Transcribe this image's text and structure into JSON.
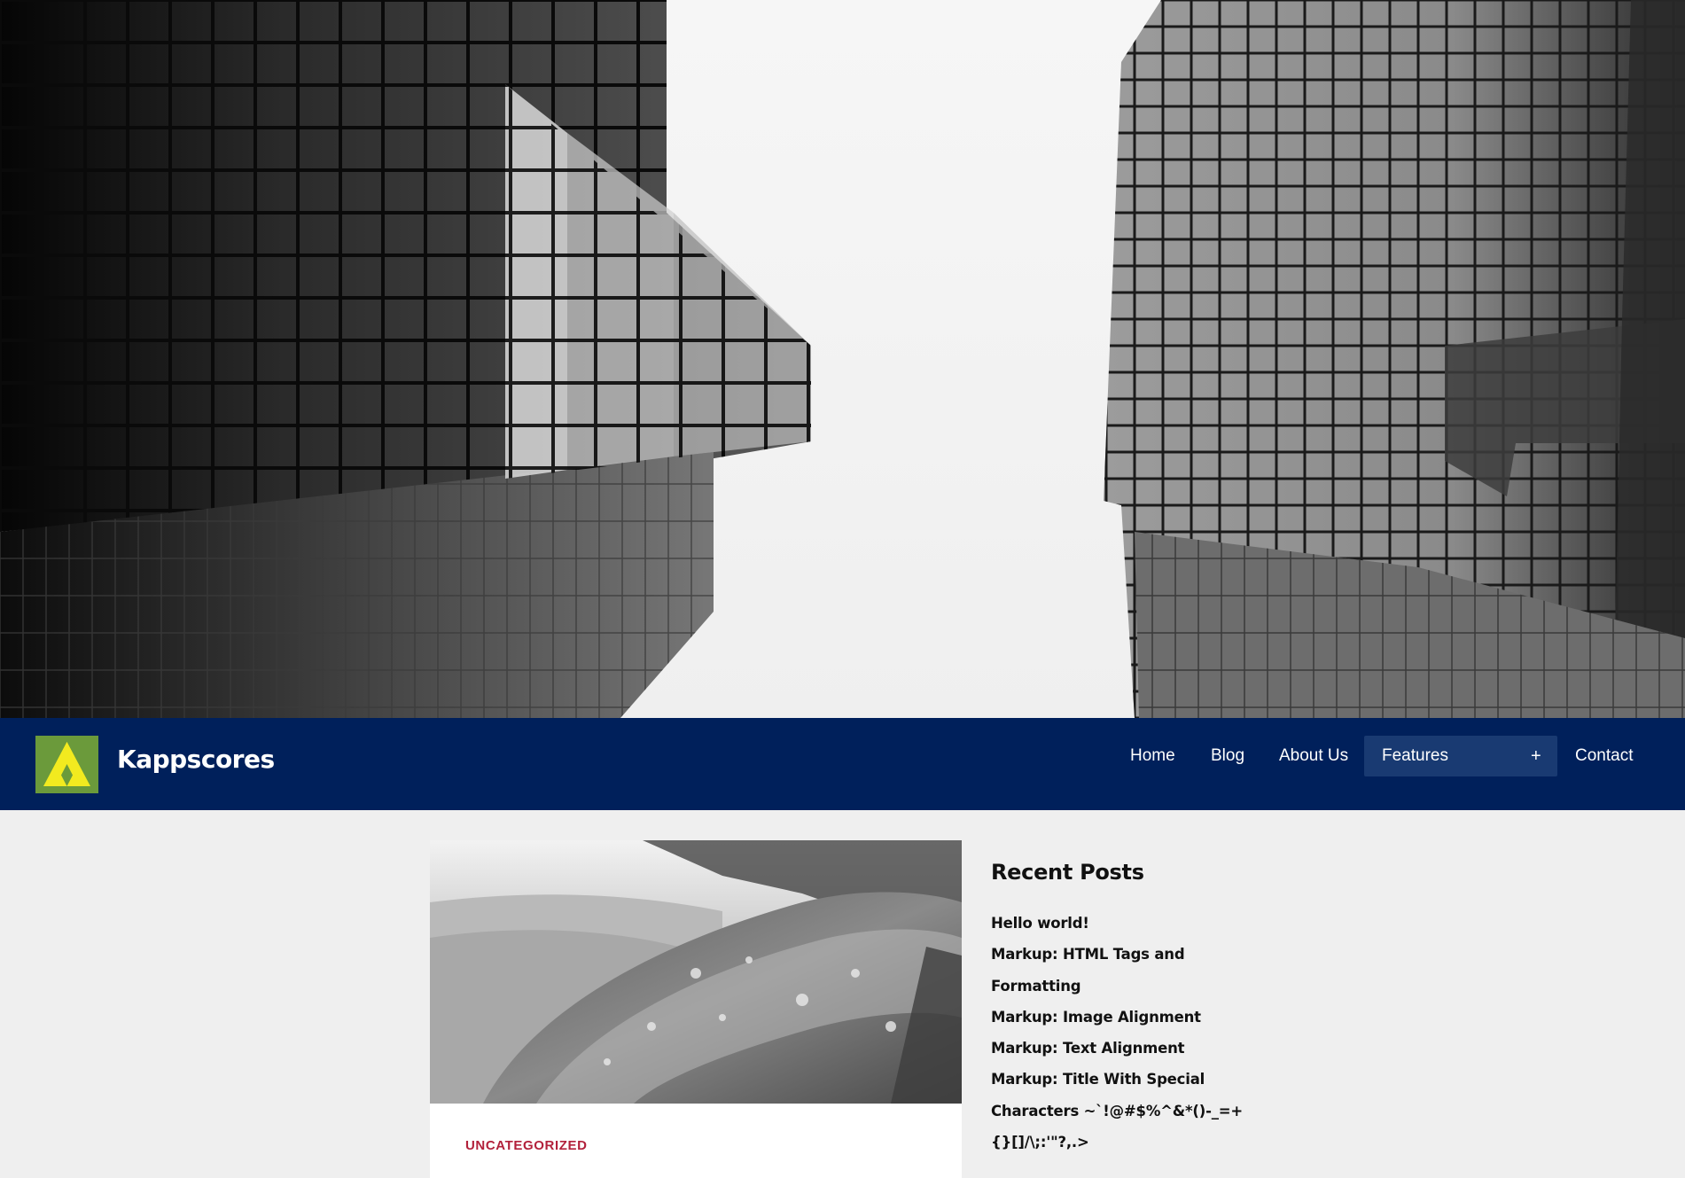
{
  "header": {
    "site_title": "Kappscores",
    "logo_icon": "triforce-logo-icon",
    "background_color": "#00205b"
  },
  "nav": {
    "items": [
      {
        "label": "Home"
      },
      {
        "label": "Blog"
      },
      {
        "label": "About Us"
      },
      {
        "label": "Features",
        "active": true,
        "expand_symbol": "+"
      },
      {
        "label": "Contact"
      }
    ]
  },
  "post": {
    "category": "UNCATEGORIZED",
    "category_color": "#b2213b"
  },
  "sidebar": {
    "widget_title": "Recent Posts",
    "recent_posts": [
      "Hello world!",
      "Markup: HTML Tags and",
      "Formatting",
      "Markup: Image Alignment",
      "Markup: Text Alignment",
      "Markup: Title With Special",
      "Characters ~`!@#$%^&*()-_=+",
      "{}[]/\\;:'\"?,.>"
    ]
  }
}
